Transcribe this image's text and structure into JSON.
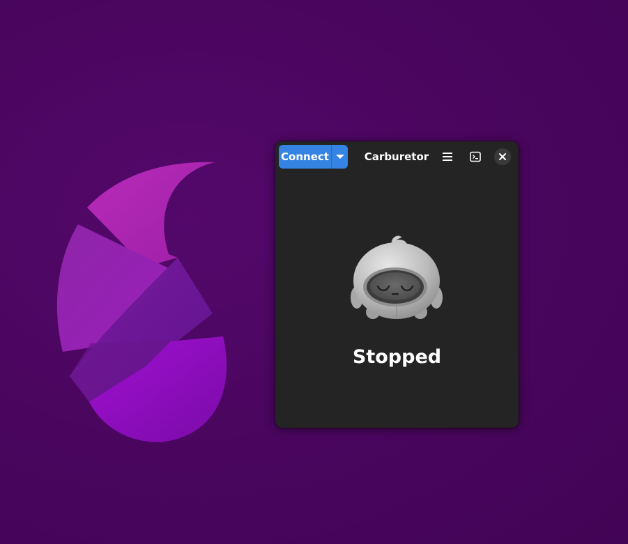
{
  "window": {
    "title": "Carburetor"
  },
  "headerbar": {
    "connect_label": "Connect",
    "dropdown_icon": "pan-down-icon",
    "menu_icon": "hamburger-menu-icon",
    "terminal_icon": "terminal-icon",
    "close_icon": "close-icon"
  },
  "content": {
    "status": "Stopped",
    "mascot_icon": "sleeping-robot-mascot"
  },
  "colors": {
    "accent": "#3584e4",
    "window_bg": "#242424",
    "desktop_bg": "#4a0657"
  }
}
